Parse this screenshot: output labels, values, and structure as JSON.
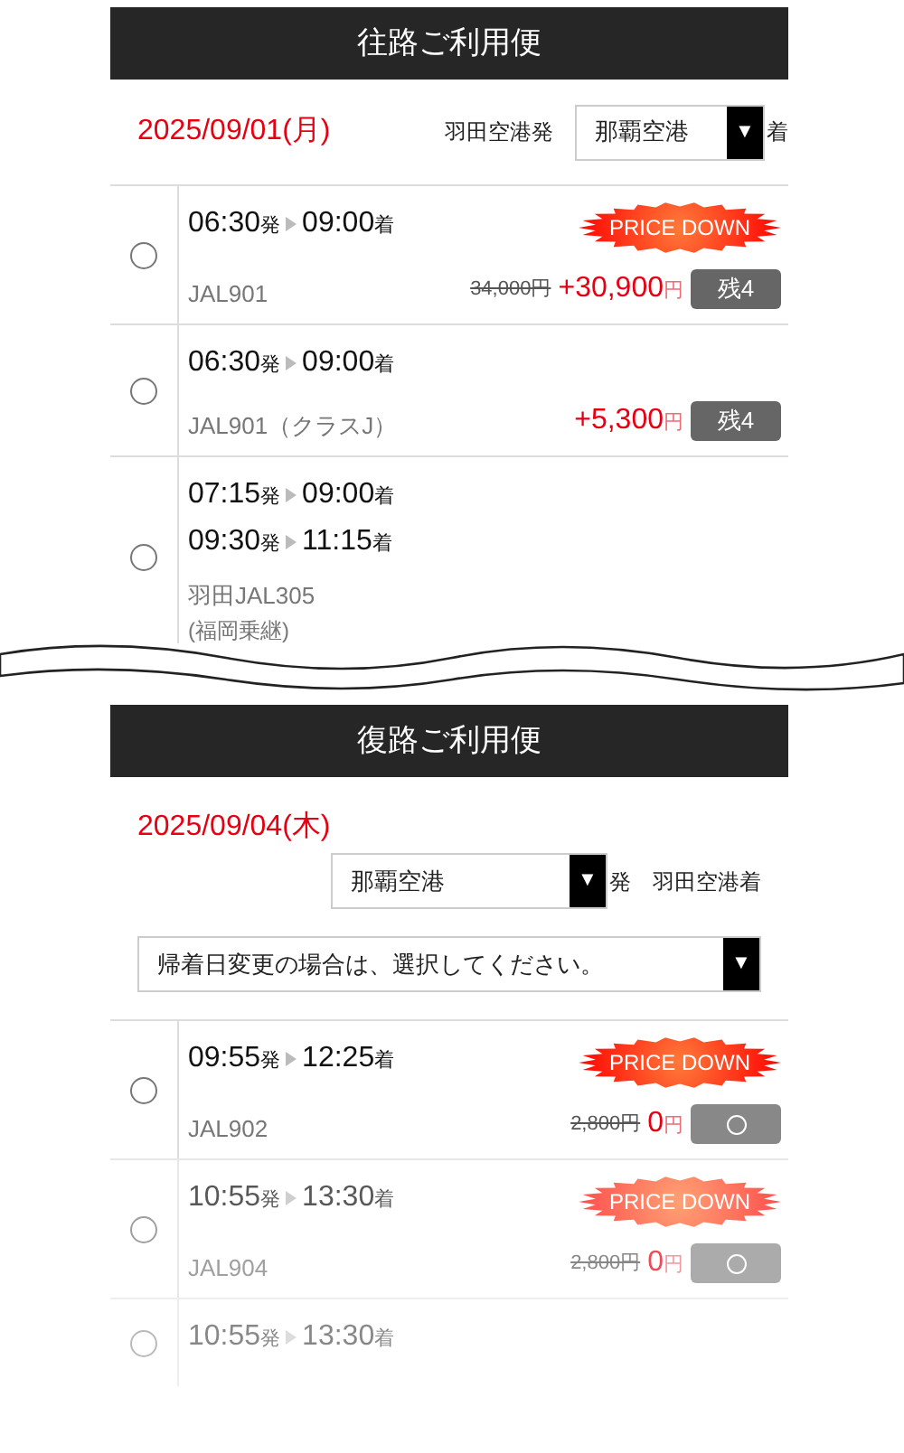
{
  "outbound": {
    "title": "往路ご利用便",
    "date": "2025/09/01(月)",
    "from_label": "羽田空港発",
    "to_select": {
      "value": "那覇空港",
      "arrow": "▼"
    },
    "to_suffix": "着",
    "flights": [
      {
        "selected": false,
        "legs": [
          {
            "dep": "06:30",
            "dep_suffix": "発",
            "arr": "09:00",
            "arr_suffix": "着"
          }
        ],
        "flight": [
          "JAL901"
        ],
        "price_down": "PRICE DOWN",
        "old_price": "34,000円",
        "price": "+30,900",
        "price_unit": "円",
        "badge": {
          "kind": "text",
          "text": "残4"
        }
      },
      {
        "selected": false,
        "legs": [
          {
            "dep": "06:30",
            "dep_suffix": "発",
            "arr": "09:00",
            "arr_suffix": "着"
          }
        ],
        "flight": [
          "JAL901（クラスJ）"
        ],
        "price": "+5,300",
        "price_unit": "円",
        "badge": {
          "kind": "text",
          "text": "残4"
        }
      },
      {
        "selected": false,
        "legs": [
          {
            "dep": "07:15",
            "dep_suffix": "発",
            "arr": "09:00",
            "arr_suffix": "着"
          },
          {
            "dep": "09:30",
            "dep_suffix": "発",
            "arr": "11:15",
            "arr_suffix": "着"
          }
        ],
        "flight": [
          "羽田JAL305",
          "(福岡乗継)"
        ]
      }
    ]
  },
  "inbound": {
    "title": "復路ご利用便",
    "date": "2025/09/04(木)",
    "from_select": {
      "value": "那覇空港",
      "arrow": "▼"
    },
    "from_suffix": "発",
    "to_label": "羽田空港着",
    "date_select": {
      "value": "帰着日変更の場合は、選択してください。",
      "arrow": "▼"
    },
    "flights": [
      {
        "selected": false,
        "legs": [
          {
            "dep": "09:55",
            "dep_suffix": "発",
            "arr": "12:25",
            "arr_suffix": "着"
          }
        ],
        "flight": [
          "JAL902"
        ],
        "price_down": "PRICE DOWN",
        "old_price": "2,800円",
        "price": "0",
        "price_unit": "円",
        "badge": {
          "kind": "circle"
        }
      },
      {
        "selected": false,
        "legs": [
          {
            "dep": "10:55",
            "dep_suffix": "発",
            "arr": "13:30",
            "arr_suffix": "着"
          }
        ],
        "flight": [
          "JAL904"
        ],
        "price_down": "PRICE DOWN",
        "old_price": "2,800円",
        "price": "0",
        "price_unit": "円",
        "badge": {
          "kind": "circle"
        }
      },
      {
        "selected": false,
        "legs": [
          {
            "dep": "10:55",
            "dep_suffix": "発",
            "arr": "13:30",
            "arr_suffix": "着"
          }
        ]
      }
    ]
  }
}
